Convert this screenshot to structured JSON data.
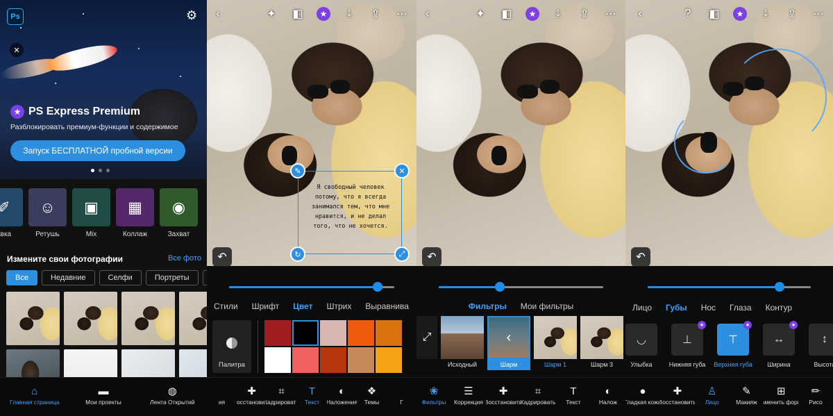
{
  "colors": {
    "accent": "#2d8fe0",
    "premium": "#7b3fe4"
  },
  "home": {
    "premium_title": "PS Express Premium",
    "premium_subtitle": "Разблокировать премиум-функции и содержимое",
    "trial_button": "Запуск БЕСПЛАТНОЙ пробной версии",
    "tools": [
      {
        "label": "авка",
        "icon": "brush-icon",
        "color": "#244a6b"
      },
      {
        "label": "Ретушь",
        "icon": "retouch-face-icon",
        "color": "#3a3d5e"
      },
      {
        "label": "Mix",
        "icon": "mix-image-icon",
        "color": "#1f4d45"
      },
      {
        "label": "Коллаж",
        "icon": "collage-icon",
        "color": "#54276a"
      },
      {
        "label": "Захват",
        "icon": "camera-icon",
        "color": "#2f5a2b"
      }
    ],
    "section_title": "Измените свои фотографии",
    "section_link": "Все фото",
    "chips": [
      "Все",
      "Недавние",
      "Селфи",
      "Портреты",
      "С"
    ],
    "nav": [
      {
        "label": "Главная страница",
        "icon": "home-icon",
        "active": true
      },
      {
        "label": "Мои проекты",
        "icon": "folder-icon",
        "active": false
      },
      {
        "label": "Лента Открытий",
        "icon": "globe-icon",
        "active": false
      }
    ]
  },
  "text_editor": {
    "slider_value": 0.9,
    "tabs": [
      "Стили",
      "Шрифт",
      "Цвет",
      "Штрих",
      "Выравнива"
    ],
    "active_tab": "Цвет",
    "overlay_text": "Я свободный человек потому, что я всегда занимался тем, что мне нравится, и не делал того, что не хочется.",
    "palette_label": "Палитра",
    "swatches": [
      "#a11d1f",
      "#000000",
      "#d9b5b1",
      "#ef5a0f",
      "#d8730c",
      "#ffffff",
      "#f0615e",
      "#b8360e",
      "#c8895a",
      "#f7a318"
    ],
    "selected_swatch": 1,
    "nav": [
      {
        "label": "ия",
        "icon": "",
        "active": false
      },
      {
        "label": "Восстановить",
        "icon": "bandage-icon",
        "active": false
      },
      {
        "label": "Кадрировать",
        "icon": "crop-icon",
        "active": false
      },
      {
        "label": "Текст",
        "icon": "text-icon",
        "active": true
      },
      {
        "label": "Наложения",
        "icon": "overlay-icon",
        "active": false
      },
      {
        "label": "Темы",
        "icon": "themes-icon",
        "active": false
      },
      {
        "label": "Г",
        "icon": "",
        "active": false
      }
    ]
  },
  "filters_editor": {
    "slider_value": 0.37,
    "tabs": [
      "Фильтры",
      "Мои фильтры"
    ],
    "active_tab": "Фильтры",
    "filters": [
      {
        "label": "Исходный",
        "style": "normal"
      },
      {
        "label": "Шарм",
        "style": "active"
      },
      {
        "label": "Шарм 1",
        "style": "blue"
      },
      {
        "label": "Шарм 3",
        "style": "normal"
      }
    ],
    "nav": [
      {
        "label": "Фильтры",
        "icon": "filters-icon",
        "active": true
      },
      {
        "label": "Коррекция",
        "icon": "sliders-icon",
        "active": false
      },
      {
        "label": "Восстановить",
        "icon": "bandage-icon",
        "active": false
      },
      {
        "label": "Кадрировать",
        "icon": "crop-icon",
        "active": false
      },
      {
        "label": "Текст",
        "icon": "text-icon",
        "active": false
      },
      {
        "label": "Налож",
        "icon": "overlay-icon",
        "active": false
      }
    ]
  },
  "face_editor": {
    "slider_value": 0.81,
    "tabs": [
      "Лицо",
      "Губы",
      "Нос",
      "Глаза",
      "Контур"
    ],
    "active_tab": "Губы",
    "features": [
      {
        "label": "Улыбка",
        "icon": "smile-icon",
        "premium": false,
        "active": false
      },
      {
        "label": "Нижняя губа",
        "icon": "lower-lip-icon",
        "premium": true,
        "active": false
      },
      {
        "label": "Верхняя губа",
        "icon": "upper-lip-icon",
        "premium": true,
        "active": true
      },
      {
        "label": "Ширина",
        "icon": "width-icon",
        "premium": true,
        "active": false
      },
      {
        "label": "Высота",
        "icon": "height-icon",
        "premium": false,
        "active": false
      }
    ],
    "nav": [
      {
        "label": "Гладкая кожа",
        "icon": "drop-icon",
        "active": false
      },
      {
        "label": "Восстановить",
        "icon": "bandage-icon",
        "active": false
      },
      {
        "label": "Лицо",
        "icon": "person-icon",
        "active": true
      },
      {
        "label": "Макияж",
        "icon": "makeup-brush-icon",
        "active": false
      },
      {
        "label": "Изменить форму",
        "icon": "grid-reshape-icon",
        "active": false
      },
      {
        "label": "Рисо",
        "icon": "pencil-icon",
        "active": false
      }
    ]
  }
}
